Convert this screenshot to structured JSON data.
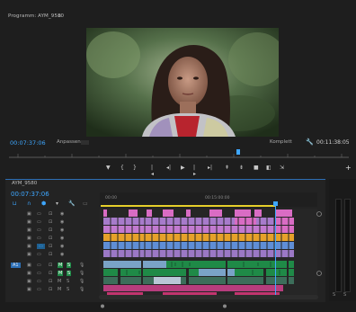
{
  "monitor": {
    "title": "Programm: AYM_9580",
    "menu_icon": "hamburger-icon",
    "timecode_current": "00:07:37:06",
    "fit_label": "Anpassen",
    "quality_label": "Komplett",
    "timecode_duration": "00:11:38:05",
    "controls": [
      "marker-icon",
      "in-point-icon",
      "out-point-icon",
      "go-to-in-icon",
      "step-back-icon",
      "play-icon",
      "step-forward-icon",
      "go-to-out-icon",
      "lift-icon",
      "extract-icon",
      "export-frame-icon",
      "comparison-icon",
      "trim-icon"
    ],
    "add_button": "+"
  },
  "timeline": {
    "title": "AYM_9580",
    "timecode": "00:07:37:06",
    "ruler_labels": [
      "00:00",
      "00:15:00:00"
    ],
    "tools": [
      "snap-icon",
      "linked-selection-icon",
      "add-marker-icon",
      "wrench-icon",
      "captions-icon"
    ]
  },
  "tracks": {
    "video_rows": 6,
    "audio_rows": 6,
    "colors": {
      "purple": "#a77bcb",
      "pink": "#d96cc4",
      "orange": "#e6a12a",
      "blue": "#5f8ed6",
      "green": "#1f8a47",
      "steel": "#7aa3c7",
      "magenta": "#c2356f"
    }
  },
  "meters": {
    "solo_left": "S",
    "solo_right": "S"
  }
}
